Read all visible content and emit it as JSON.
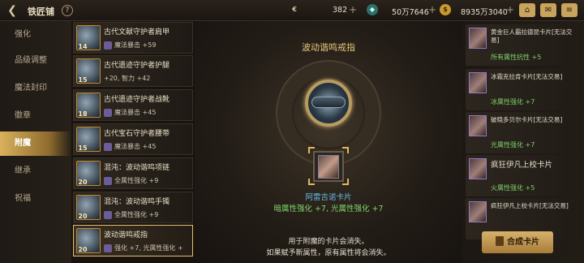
{
  "header": {
    "title": "铁匠铺",
    "currencies": [
      {
        "icon": "gold-coin-icon",
        "value": "382"
      },
      {
        "icon": "crystal-icon",
        "value": "50万7646"
      },
      {
        "icon": "gold-icon",
        "value": "8935万3040"
      }
    ]
  },
  "nav": {
    "items": [
      {
        "label": "强化"
      },
      {
        "label": "品级调整"
      },
      {
        "label": "魔法封印"
      },
      {
        "label": "徽章"
      },
      {
        "label": "附魔"
      },
      {
        "label": "继承"
      },
      {
        "label": "祝福"
      }
    ],
    "active_index": 4
  },
  "equipment_list": [
    {
      "name": "古代文献守护者肩甲",
      "level": "14",
      "stat": "魔法暴击 +59"
    },
    {
      "name": "古代遗迹守护者护腿",
      "level": "15",
      "stat": "+20, 智力 +42"
    },
    {
      "name": "古代遗迹守护者战靴",
      "level": "18",
      "stat": "魔法暴击 +45"
    },
    {
      "name": "古代宝石守护者腰带",
      "level": "15",
      "stat": "魔法暴击 +45"
    },
    {
      "name": "混沌：波动谐鸣项链",
      "level": "20",
      "stat": "全属性强化 +9"
    },
    {
      "name": "混沌：波动谐鸣手镯",
      "level": "20",
      "stat": "全属性强化 +9"
    },
    {
      "name": "波动谐鸣戒指",
      "level": "20",
      "stat": "强化 +7, 光属性强化 +"
    }
  ],
  "center": {
    "item_title": "波动谐鸣戒指",
    "card_name": "阿雷吉诺卡片",
    "card_effect": "暗属性强化 +7, 光属性强化 +7",
    "note_line1": "用于附魔的卡片会消失。",
    "note_line2": "如果赋予新属性，原有属性将会消失。"
  },
  "cards": [
    {
      "name": "黄金巨人霸拉德昆卡片[无法交易]",
      "effect": "所有属性抗性 +5"
    },
    {
      "name": "冰霜克拉肯卡片[无法交易]",
      "effect": "冰属性强化 +7"
    },
    {
      "name": "破晓多贝尔卡片[无法交易]",
      "effect": "光属性强化 +7"
    },
    {
      "name": "疯狂伊凡上校卡片",
      "effect": "火属性强化 +5"
    },
    {
      "name": "疯狂伊凡上校卡片[无法交易]",
      "effect": ""
    }
  ],
  "compose_button": "合成卡片",
  "colors": {
    "accent_gold": "#d9b15d",
    "card_name_blue": "#6ab8e6",
    "effect_green": "#7fd26a"
  }
}
